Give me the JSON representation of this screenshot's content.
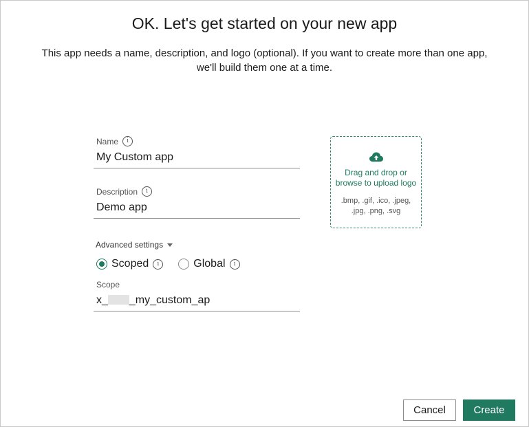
{
  "header": {
    "title": "OK. Let's get started on your new app",
    "subtitle_line1": "This app needs a name, description, and logo (optional). If you want to create more than one app,",
    "subtitle_line2": "we'll build them one at a time."
  },
  "form": {
    "name": {
      "label": "Name",
      "value": "My Custom app"
    },
    "description": {
      "label": "Description",
      "value": "Demo app"
    },
    "advanced_settings_label": "Advanced settings",
    "scope_options": [
      {
        "label": "Scoped",
        "selected": true
      },
      {
        "label": "Global",
        "selected": false
      }
    ],
    "scope": {
      "label": "Scope",
      "value_prefix": "x_",
      "value_suffix": "_my_custom_ap"
    }
  },
  "upload": {
    "icon": "cloud-upload-icon",
    "line1": "Drag and drop or",
    "line2": "browse to upload logo",
    "formats_line1": ".bmp, .gif, .ico, .jpeg,",
    "formats_line2": ".jpg, .png, .svg"
  },
  "actions": {
    "cancel_label": "Cancel",
    "create_label": "Create"
  },
  "colors": {
    "accent": "#1f7a5f",
    "border": "#8c8c8c"
  }
}
